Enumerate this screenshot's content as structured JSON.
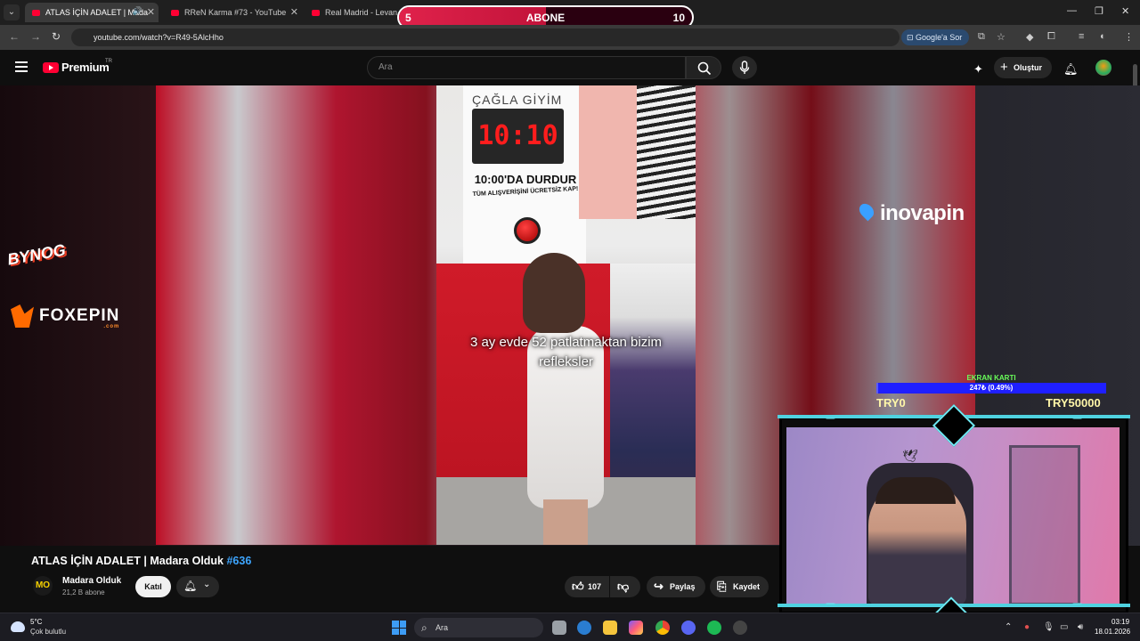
{
  "browser": {
    "tabs": [
      {
        "label": "ATLAS İÇİN ADALET | Mada",
        "active": true
      },
      {
        "label": "RReN Karma #73 - YouTube",
        "active": false
      },
      {
        "label": "Real Madrid - Levante",
        "active": false
      }
    ],
    "url": "youtube.com/watch?v=R49-5AlcHho",
    "google_sor": "Google'a Sor"
  },
  "subscribe_goal": {
    "current": "5",
    "label": "ABONE",
    "target": "10",
    "progress": 0.5
  },
  "youtube": {
    "brand": "Premium",
    "region": "TR",
    "search_placeholder": "Ara",
    "create_label": "Oluştur"
  },
  "video_content": {
    "store_brand": "ÇAĞLA GİYİM",
    "timer": "10:10",
    "stop_text": "10:00'DA DURDUR",
    "stop_sub": "TÜM ALIŞVERİŞİNİ ÜCRETSİZ KAP!",
    "subtitle_line1": "3 ay evde 52 patlatmaktan bizim",
    "subtitle_line2": "refleksler"
  },
  "sponsors": {
    "bynog": "BYNOG",
    "foxepin": "FOXEPIN",
    "foxepin_com": ".com",
    "inovapin": "inovapin"
  },
  "donation_goal": {
    "title": "EKRAN KARTI",
    "progress_text": "247₺ (0.49%)",
    "progress": 0.0049,
    "min": "TRY0",
    "max": "TRY50000"
  },
  "video": {
    "title": "ATLAS İÇİN ADALET | Madara Olduk ",
    "hashtag": "#636",
    "channel": "Madara Olduk",
    "channel_initials": "MO",
    "subscribers": "21,2 B abone",
    "join_label": "Katıl",
    "likes": "107",
    "share_label": "Paylaş",
    "save_label": "Kaydet"
  },
  "taskbar": {
    "temperature": "5°C",
    "weather": "Çok bulutlu",
    "search_label": "Ara",
    "time": "03:19",
    "date": "18.01.2026"
  },
  "colors": {
    "accent_red": "#ff0033",
    "link_blue": "#3ea6ff",
    "goal_green": "#69ff5a",
    "cam_cyan": "#6ee8f2"
  }
}
